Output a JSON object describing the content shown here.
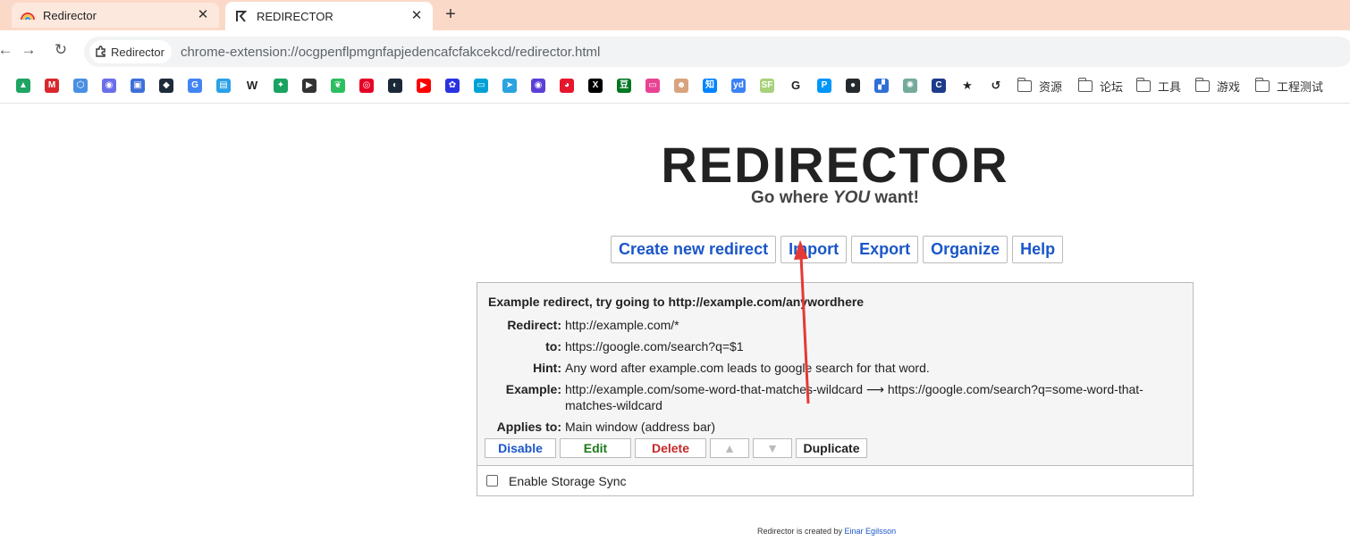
{
  "browser": {
    "tabs": [
      {
        "title": "Redirector",
        "close": "✕",
        "active": false
      },
      {
        "title": "REDIRECTOR",
        "close": "✕",
        "active": true
      }
    ],
    "new_tab": "+",
    "nav": {
      "back": "←",
      "forward": "→",
      "reload": "↻"
    },
    "omnibox": {
      "chip_label": "Redirector",
      "url": "chrome-extension://ocgpenflpmgnfapjedencafcfakcekcd/redirector.html"
    },
    "bookmark_folders": [
      "资源",
      "论坛",
      "工具",
      "游戏",
      "工程测试"
    ],
    "bookmark_icons": [
      {
        "name": "google-drive-icon",
        "color": "#1fa463",
        "glyph": "▲"
      },
      {
        "name": "mega-icon",
        "color": "#d9272e",
        "glyph": "M"
      },
      {
        "name": "cloud-icon",
        "color": "#4a90e2",
        "glyph": "⬡"
      },
      {
        "name": "app-icon-1",
        "color": "#6b6ee8",
        "glyph": "◉"
      },
      {
        "name": "app-icon-2",
        "color": "#3d6fd8",
        "glyph": "▣"
      },
      {
        "name": "app-icon-3",
        "color": "#1d2b3a",
        "glyph": "◆"
      },
      {
        "name": "translate-icon",
        "color": "#4285f4",
        "glyph": "G"
      },
      {
        "name": "app-icon-4",
        "color": "#2aa1e6",
        "glyph": "▤"
      },
      {
        "name": "wikipedia-icon",
        "color": "#ffffff",
        "glyph": "W"
      },
      {
        "name": "app-icon-5",
        "color": "#1aa260",
        "glyph": "✦"
      },
      {
        "name": "app-icon-6",
        "color": "#333333",
        "glyph": "▶"
      },
      {
        "name": "evernote-icon",
        "color": "#2dbe60",
        "glyph": "❦"
      },
      {
        "name": "netease-music-icon",
        "color": "#e60026",
        "glyph": "◎"
      },
      {
        "name": "steam-icon",
        "color": "#1b2838",
        "glyph": "◐"
      },
      {
        "name": "youtube-icon",
        "color": "#ff0000",
        "glyph": "▶"
      },
      {
        "name": "baidu-icon",
        "color": "#2932e1",
        "glyph": "✿"
      },
      {
        "name": "bilibili-icon",
        "color": "#00a1d6",
        "glyph": "▭"
      },
      {
        "name": "telegram-icon",
        "color": "#2aa3e0",
        "glyph": "➤"
      },
      {
        "name": "app-icon-7",
        "color": "#5b3fd6",
        "glyph": "◉"
      },
      {
        "name": "weibo-icon",
        "color": "#e6162d",
        "glyph": "◕"
      },
      {
        "name": "x-icon",
        "color": "#000000",
        "glyph": "X"
      },
      {
        "name": "douban-icon",
        "color": "#007722",
        "glyph": "豆"
      },
      {
        "name": "tv-icon",
        "color": "#e84393",
        "glyph": "▭"
      },
      {
        "name": "anime-icon",
        "color": "#d8a47f",
        "glyph": "☻"
      },
      {
        "name": "zhihu-icon",
        "color": "#0084ff",
        "glyph": "知"
      },
      {
        "name": "app-icon-8",
        "color": "#3b82f6",
        "glyph": "yd"
      },
      {
        "name": "sf-icon",
        "color": "#a8d27a",
        "glyph": "SF"
      },
      {
        "name": "google-icon",
        "color": "#ffffff",
        "glyph": "G"
      },
      {
        "name": "p-icon",
        "color": "#0096fa",
        "glyph": "P"
      },
      {
        "name": "github-icon",
        "color": "#24292e",
        "glyph": "●"
      },
      {
        "name": "app-icon-9",
        "color": "#2f6fd6",
        "glyph": "▞"
      },
      {
        "name": "openai-icon",
        "color": "#74aa9c",
        "glyph": "✺"
      },
      {
        "name": "app-icon-10",
        "color": "#1e3a8a",
        "glyph": "C"
      },
      {
        "name": "star-icon",
        "color": "#ffffff",
        "glyph": "★"
      },
      {
        "name": "history-icon",
        "color": "#ffffff",
        "glyph": "↺"
      }
    ]
  },
  "app": {
    "title": "REDIRECTOR",
    "tagline_pre": "Go where ",
    "tagline_em": "YOU",
    "tagline_post": " want!",
    "menu": [
      "Create new redirect",
      "Import",
      "Export",
      "Organize",
      "Help"
    ],
    "redirect": {
      "description": "Example redirect, try going to http://example.com/anywordhere",
      "fields": [
        {
          "label": "Redirect:",
          "value": "http://example.com/*"
        },
        {
          "label": "to:",
          "value": "https://google.com/search?q=$1"
        },
        {
          "label": "Hint:",
          "value": "Any word after example.com leads to google search for that word."
        },
        {
          "label": "Example:",
          "value": "http://example.com/some-word-that-matches-wildcard ⟶ https://google.com/search?q=some-word-that-matches-wildcard"
        },
        {
          "label": "Applies to:",
          "value": "Main window (address bar)"
        }
      ],
      "actions": {
        "disable": "Disable",
        "edit": "Edit",
        "delete": "Delete",
        "up": "▲",
        "down": "▼",
        "duplicate": "Duplicate"
      }
    },
    "storage_sync": {
      "label": "Enable Storage Sync",
      "checked": false
    },
    "footer": {
      "text": "Redirector is created by ",
      "author": "Einar Egilsson"
    }
  },
  "colors": {
    "accent": "#1a56c8",
    "edit": "#1b7a1b",
    "delete": "#c62828",
    "annotation_arrow": "#e53935"
  }
}
